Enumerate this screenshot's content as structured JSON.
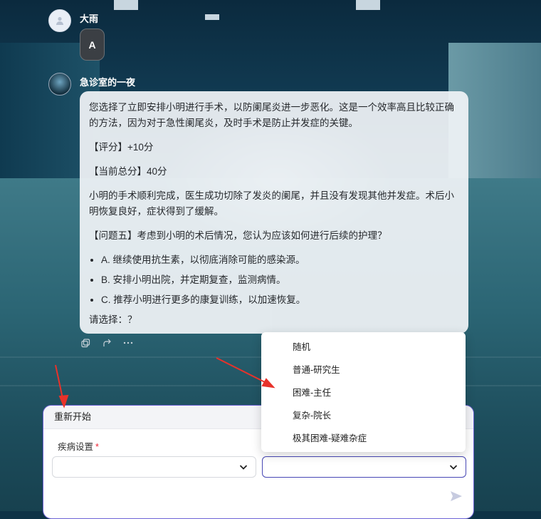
{
  "conversation": {
    "user": {
      "name": "大雨",
      "message": "A"
    },
    "bot": {
      "name": "急诊室的一夜",
      "paragraphs": [
        "您选择了立即安排小明进行手术，以防阑尾炎进一步恶化。这是一个效率高且比较正确的方法，因为对于急性阑尾炎，及时手术是防止并发症的关键。",
        "【评分】+10分",
        "【当前总分】40分",
        "小明的手术顺利完成，医生成功切除了发炎的阑尾，并且没有发现其他并发症。术后小明恢复良好，症状得到了缓解。",
        "【问题五】考虑到小明的术后情况，您认为应该如何进行后续的护理？"
      ],
      "options": [
        "A. 继续使用抗生素，以彻底消除可能的感染源。",
        "B. 安排小明出院，并定期复查，监测病情。",
        "C. 推荐小明进行更多的康复训练，以加速恢复。"
      ],
      "prompt": "请选择：？"
    }
  },
  "composer": {
    "header": "重新开始",
    "field_label": "疾病设置",
    "required_mark": "*",
    "left_select_value": "",
    "right_select_value": ""
  },
  "dropdown": {
    "options": [
      "随机",
      "普通-研究生",
      "困难-主任",
      "复杂-院长",
      "极其困难-疑难杂症"
    ]
  },
  "colors": {
    "accent": "#4747b5",
    "annotation": "#e8322a"
  }
}
